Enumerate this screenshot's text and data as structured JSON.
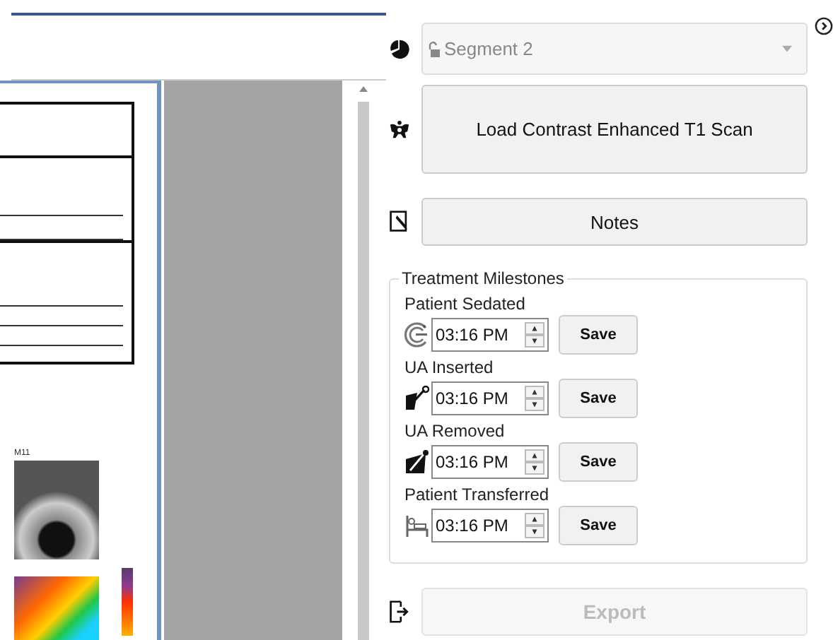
{
  "document": {
    "figure_label": "M11"
  },
  "segment_dropdown": {
    "value": "Segment 2",
    "disabled": true
  },
  "load_button": {
    "label": "Load Contrast Enhanced T1 Scan"
  },
  "notes_button": {
    "label": "Notes"
  },
  "milestones": {
    "title": "Treatment Milestones",
    "items": [
      {
        "kind": "sedated",
        "label": "Patient Sedated",
        "time": "03:16 PM",
        "button": "Save"
      },
      {
        "kind": "inserted",
        "label": "UA Inserted",
        "time": "03:16 PM",
        "button": "Save"
      },
      {
        "kind": "removed",
        "label": "UA Removed",
        "time": "03:16 PM",
        "button": "Save"
      },
      {
        "kind": "transferred",
        "label": "Patient Transferred",
        "time": "03:16 PM",
        "button": "Save"
      }
    ]
  },
  "export_button": {
    "label": "Export",
    "disabled": true
  }
}
